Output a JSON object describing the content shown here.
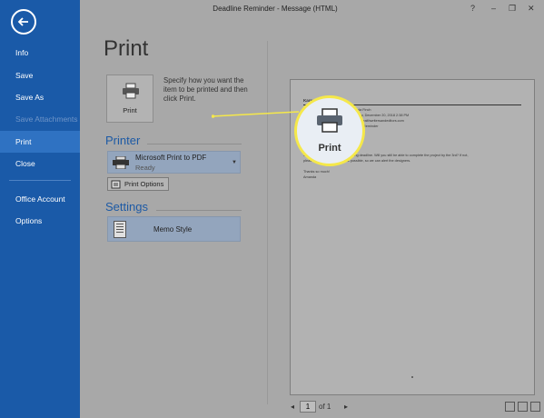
{
  "window": {
    "title": "Deadline Reminder - Message (HTML)",
    "help": "?",
    "minimize": "–",
    "restore": "❐",
    "close": "✕"
  },
  "sidebar": {
    "items": [
      {
        "label": "Info"
      },
      {
        "label": "Save"
      },
      {
        "label": "Save As"
      },
      {
        "label": "Save Attachments"
      },
      {
        "label": "Print"
      },
      {
        "label": "Close"
      },
      {
        "label": "Office Account"
      },
      {
        "label": "Options"
      }
    ]
  },
  "main": {
    "title": "Print",
    "print_button_label": "Print",
    "print_description": "Specify how you want the item to be printed and then click Print.",
    "printer_heading": "Printer",
    "printer_name": "Microsoft Print to PDF",
    "printer_status": "Ready",
    "print_options_label": "Print Options",
    "settings_heading": "Settings",
    "style_label": "Memo Style"
  },
  "preview": {
    "from_name": "Karen Marcus",
    "headers": [
      {
        "key": "From:",
        "value": "Amanda Finch"
      },
      {
        "key": "Sent:",
        "value": "Thursday, December 20, 2018 2:38 PM"
      },
      {
        "key": "To:",
        "value": "karen@healthwritersandeditors.com"
      },
      {
        "key": "Subject:",
        "value": "Deadline Reminder"
      }
    ],
    "body": [
      "Hi Karen,",
      "Just a reminder about the upcoming deadline. Will you still be able to complete the project by the 3rd? If not,",
      "please let us know as soon as possible, so we can alert the designers.",
      "Thanks so much!",
      "Amanda"
    ]
  },
  "pager": {
    "current_page": "1",
    "of_label": "of 1"
  },
  "callout": {
    "label": "Print"
  }
}
